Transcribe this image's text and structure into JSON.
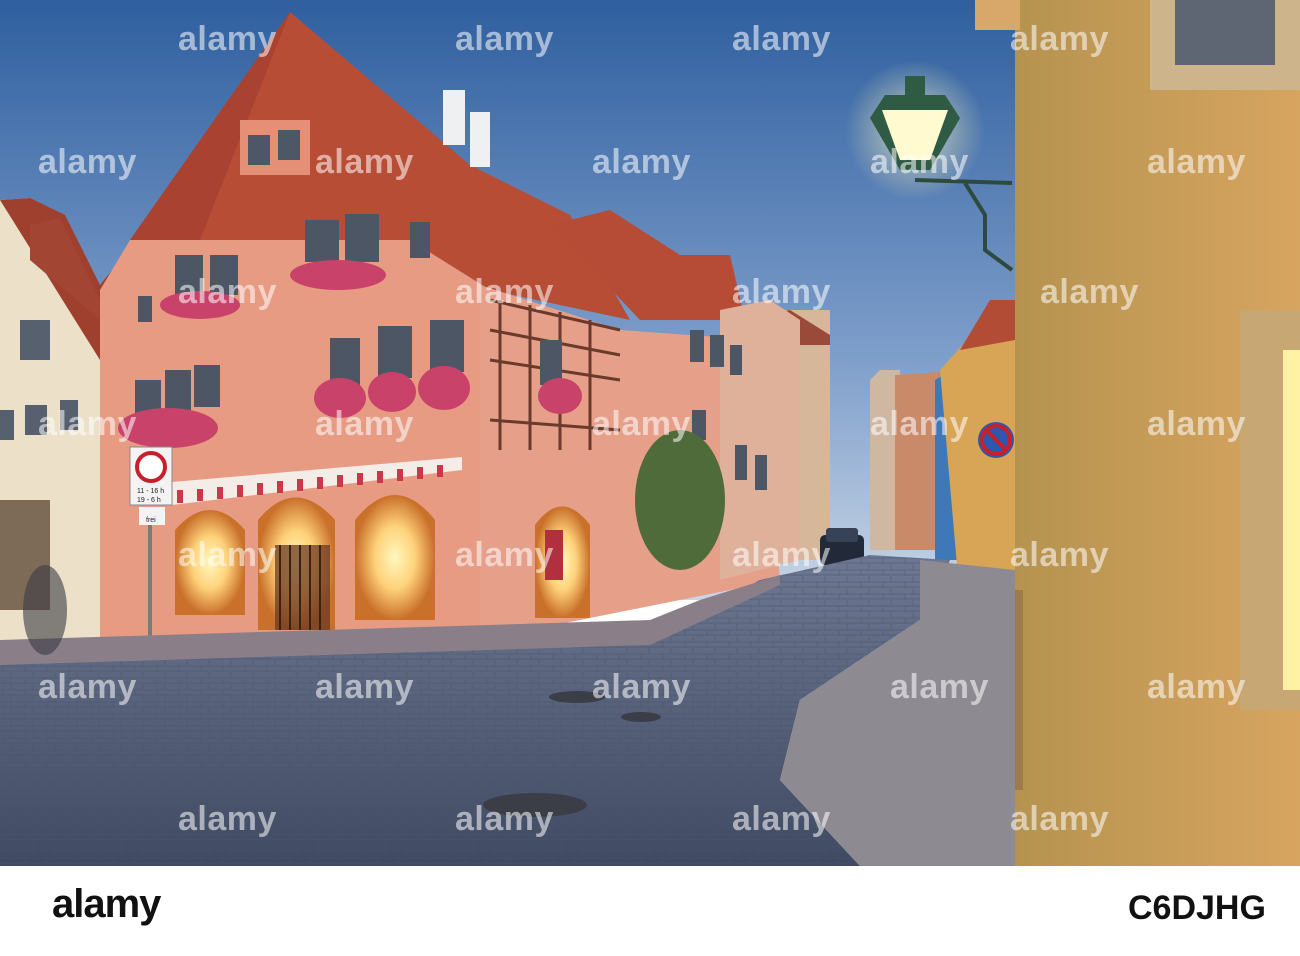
{
  "photo": {
    "sky_top": "#3a69a8",
    "sky_bottom": "#b9cbe2",
    "facade_color": "#e9a18a",
    "roof_color": "#b5503a",
    "street_color": "#5b6780",
    "lamp_glow": "#fff4a8",
    "sign_hours": [
      "11 - 16 h",
      "19 - 6 h"
    ],
    "sign_sub": "frei"
  },
  "watermark": {
    "text": "alamy"
  },
  "footer": {
    "brand": "alamy",
    "image_id": "C6DJHG"
  }
}
